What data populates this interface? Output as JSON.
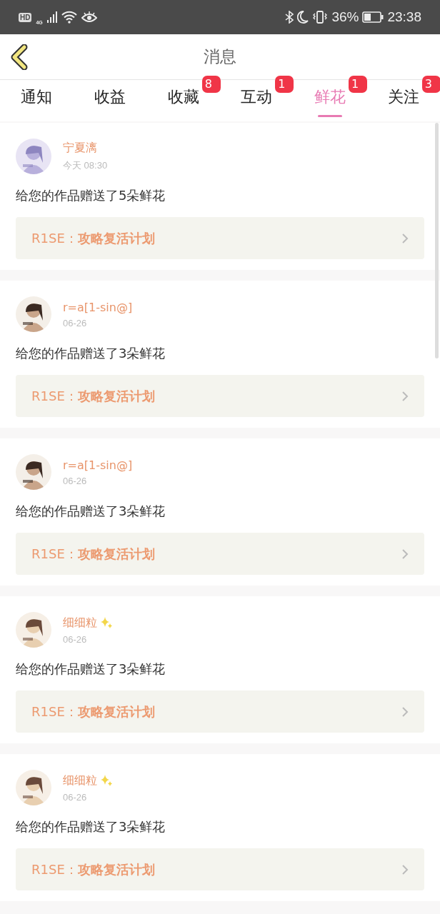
{
  "status_bar": {
    "hd": "HD",
    "network": "4G",
    "battery": "36%",
    "time": "23:38"
  },
  "header": {
    "title": "消息"
  },
  "tabs": [
    {
      "label": "通知",
      "selected": false
    },
    {
      "label": "收益",
      "selected": false
    },
    {
      "label": "收藏",
      "selected": false,
      "badge": "8"
    },
    {
      "label": "互动",
      "selected": false,
      "badge": "1"
    },
    {
      "label": "鲜花",
      "selected": true,
      "badge": "1"
    },
    {
      "label": "关注",
      "selected": false,
      "badge": "3"
    }
  ],
  "messages": [
    {
      "user": "宁夏漓",
      "sparkle": false,
      "time": "今天 08:30",
      "text": "给您的作品赠送了5朵鲜花",
      "work": "R1SE：**攻略复活计划**"
    },
    {
      "user": "r=a[1-sin@]",
      "sparkle": false,
      "time": "06-26",
      "text": "给您的作品赠送了3朵鲜花",
      "work": "R1SE：**攻略复活计划**"
    },
    {
      "user": "r=a[1-sin@]",
      "sparkle": false,
      "time": "06-26",
      "text": "给您的作品赠送了3朵鲜花",
      "work": "R1SE：**攻略复活计划**"
    },
    {
      "user": "细细粒",
      "sparkle": true,
      "time": "06-26",
      "text": "给您的作品赠送了3朵鲜花",
      "work": "R1SE：**攻略复活计划**"
    },
    {
      "user": "细细粒",
      "sparkle": true,
      "time": "06-26",
      "text": "给您的作品赠送了3朵鲜花",
      "work": "R1SE：**攻略复活计划**"
    }
  ]
}
